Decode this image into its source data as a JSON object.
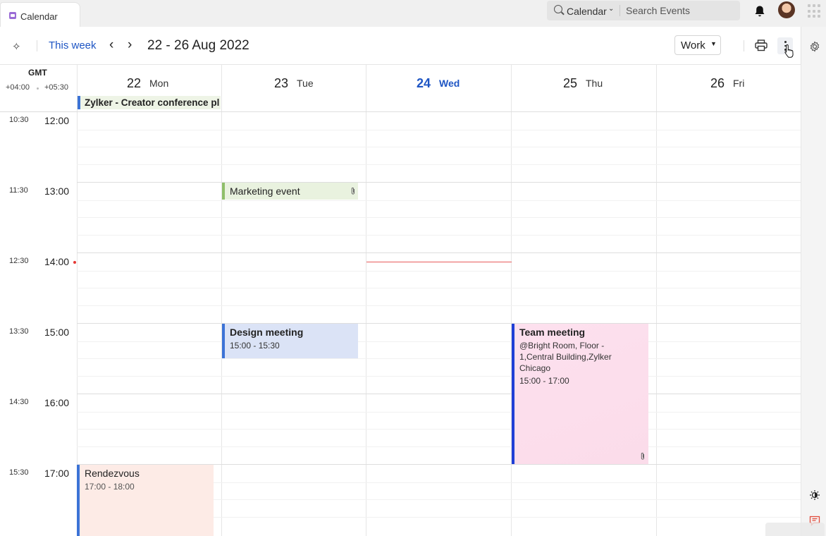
{
  "app_tab": {
    "title": "Calendar"
  },
  "search": {
    "scope": "Calendar",
    "placeholder": "Search Events"
  },
  "toolbar": {
    "this_week": "This week",
    "date_range": "22 - 26 Aug 2022",
    "view": "Work"
  },
  "timezone": {
    "label": "GMT",
    "primary": "+04:00",
    "secondary": "+05:30"
  },
  "days": [
    {
      "num": "22",
      "name": "Mon",
      "today": false
    },
    {
      "num": "23",
      "name": "Tue",
      "today": false
    },
    {
      "num": "24",
      "name": "Wed",
      "today": true
    },
    {
      "num": "25",
      "name": "Thu",
      "today": false
    },
    {
      "num": "26",
      "name": "Fri",
      "today": false
    }
  ],
  "all_day_events": [
    {
      "title": "Zylker - Creator conference pl",
      "day": "Mon"
    }
  ],
  "hours": [
    {
      "secondary": "10:30",
      "primary": "12:00"
    },
    {
      "secondary": "11:30",
      "primary": "13:00"
    },
    {
      "secondary": "12:30",
      "primary": "14:00"
    },
    {
      "secondary": "13:30",
      "primary": "15:00"
    },
    {
      "secondary": "14:30",
      "primary": "16:00"
    },
    {
      "secondary": "15:30",
      "primary": "17:00"
    }
  ],
  "events": {
    "marketing": {
      "title": "Marketing event",
      "day": "Tue",
      "has_attachment": true
    },
    "design": {
      "title": "Design meeting",
      "time": "15:00 - 15:30",
      "day": "Tue"
    },
    "team": {
      "title": "Team meeting",
      "location_line1": "@Bright Room, Floor -",
      "location_line2": "1,Central Building,Zylker",
      "location_line3": "Chicago",
      "time": "15:00 - 17:00",
      "day": "Thu",
      "has_attachment": true
    },
    "rendezvous": {
      "title": "Rendezvous",
      "time": "17:00 - 18:00",
      "day": "Mon"
    }
  },
  "icons": [
    "calendar-app-icon",
    "search-icon",
    "chevron-down-icon",
    "bell-icon",
    "avatar",
    "apps-grid-icon",
    "add-event-icon",
    "chevron-left-icon",
    "chevron-right-icon",
    "print-icon",
    "more-options-icon",
    "settings-icon",
    "theme-icon",
    "feedback-icon",
    "attachment-icon"
  ],
  "colors": {
    "accent": "#1f56c4",
    "now_line": "#e85c5c",
    "today": "#1f56c4"
  }
}
